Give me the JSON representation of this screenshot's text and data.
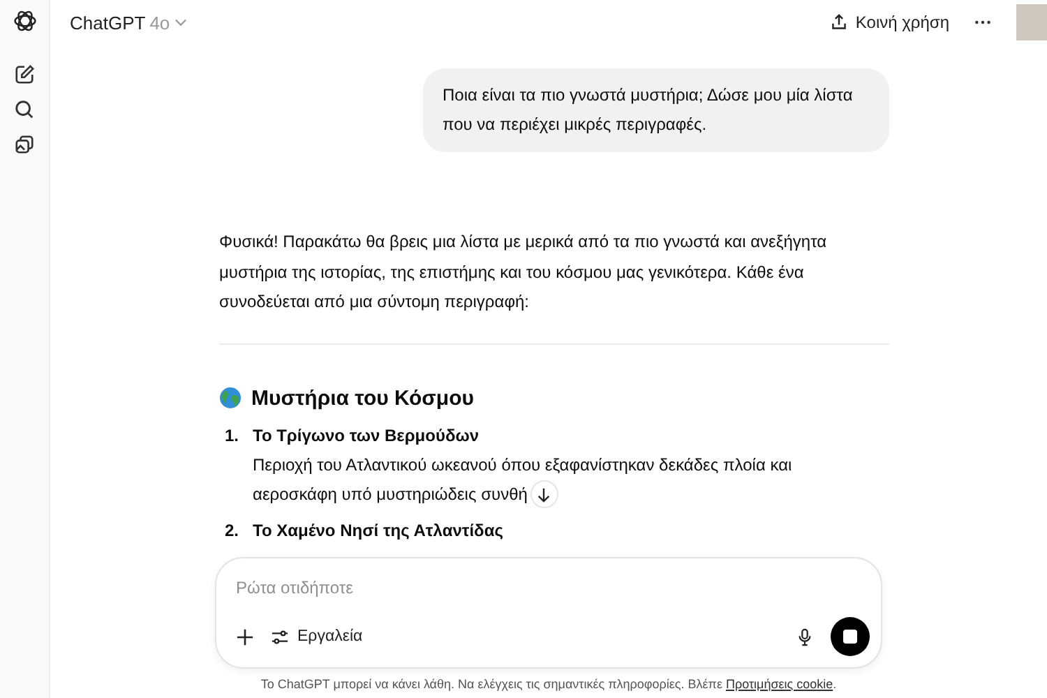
{
  "header": {
    "model_name": "ChatGPT",
    "model_version": "4o",
    "share_label": "Κοινή χρήση"
  },
  "user_message": "Ποια είναι τα πιο γνωστά μυστήρια; Δώσε μου μία λίστα που να περιέχει μικρές περιγραφές.",
  "assistant": {
    "intro": "Φυσικά! Παρακάτω θα βρεις μια λίστα με μερικά από τα πιο γνωστά και ανεξήγητα μυστήρια της ιστορίας, της επιστήμης και του κόσμου μας γενικότερα. Κάθε ένα συνοδεύεται από μια σύντομη περιγραφή:",
    "section_title": "Μυστήρια του Κόσμου",
    "items": [
      {
        "number": "1.",
        "title": "Το Τρίγωνο των Βερμούδων",
        "description": [
          "Περιοχή του Ατλαντικού ωκεανού όπου εξαφανίστηκαν δεκάδες πλοία και",
          "αεροσκάφη υπό μυστηριώδεις συνθή"
        ]
      },
      {
        "number": "2.",
        "title": "Το Χαμένο Νησί της Ατλαντίδας"
      }
    ]
  },
  "composer": {
    "placeholder": "Ρώτα οτιδήποτε",
    "tools_label": "Εργαλεία"
  },
  "footer": {
    "text": "Το ChatGPT μπορεί να κάνει λάθη. Να ελέγχεις τις σημαντικές πληροφορίες. Βλέπε",
    "link": "Προτιμήσεις cookie",
    "end": "."
  }
}
